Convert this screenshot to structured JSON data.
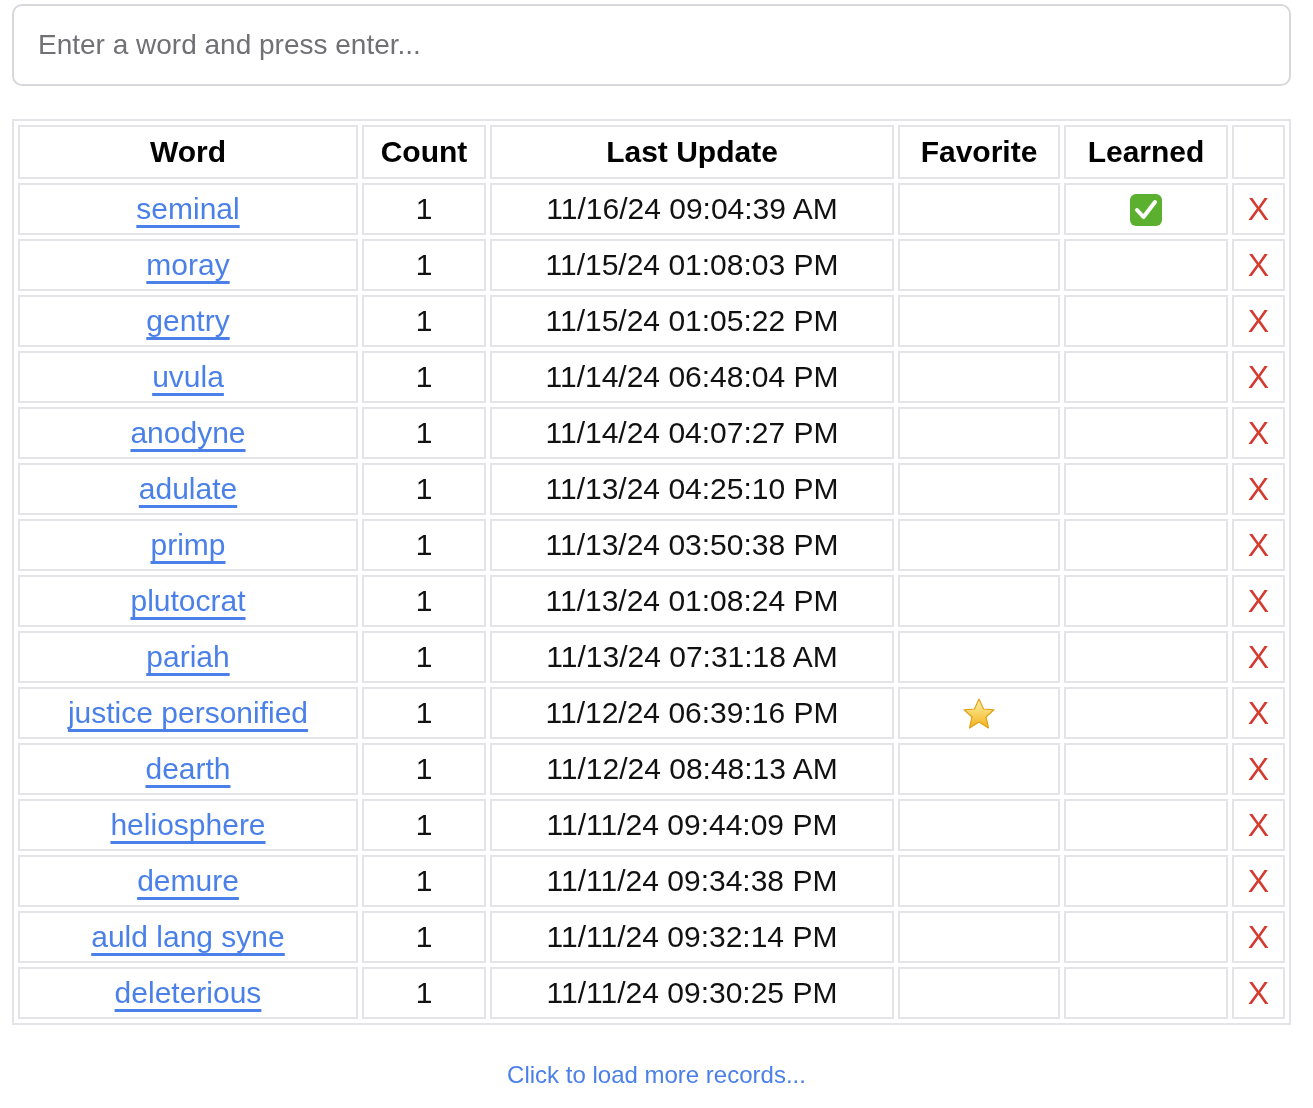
{
  "search": {
    "placeholder": "Enter a word and press enter..."
  },
  "table": {
    "columns": [
      "Word",
      "Count",
      "Last Update",
      "Favorite",
      "Learned"
    ],
    "rows": [
      {
        "word": "seminal",
        "count": "1",
        "last_update": "11/16/24 09:04:39 AM",
        "favorite": false,
        "learned": true,
        "delete": "X"
      },
      {
        "word": "moray",
        "count": "1",
        "last_update": "11/15/24 01:08:03 PM",
        "favorite": false,
        "learned": false,
        "delete": "X"
      },
      {
        "word": "gentry",
        "count": "1",
        "last_update": "11/15/24 01:05:22 PM",
        "favorite": false,
        "learned": false,
        "delete": "X"
      },
      {
        "word": "uvula",
        "count": "1",
        "last_update": "11/14/24 06:48:04 PM",
        "favorite": false,
        "learned": false,
        "delete": "X"
      },
      {
        "word": "anodyne",
        "count": "1",
        "last_update": "11/14/24 04:07:27 PM",
        "favorite": false,
        "learned": false,
        "delete": "X"
      },
      {
        "word": "adulate",
        "count": "1",
        "last_update": "11/13/24 04:25:10 PM",
        "favorite": false,
        "learned": false,
        "delete": "X"
      },
      {
        "word": "primp",
        "count": "1",
        "last_update": "11/13/24 03:50:38 PM",
        "favorite": false,
        "learned": false,
        "delete": "X"
      },
      {
        "word": "plutocrat",
        "count": "1",
        "last_update": "11/13/24 01:08:24 PM",
        "favorite": false,
        "learned": false,
        "delete": "X"
      },
      {
        "word": "pariah",
        "count": "1",
        "last_update": "11/13/24 07:31:18 AM",
        "favorite": false,
        "learned": false,
        "delete": "X"
      },
      {
        "word": "justice personified",
        "count": "1",
        "last_update": "11/12/24 06:39:16 PM",
        "favorite": true,
        "learned": false,
        "delete": "X"
      },
      {
        "word": "dearth",
        "count": "1",
        "last_update": "11/12/24 08:48:13 AM",
        "favorite": false,
        "learned": false,
        "delete": "X"
      },
      {
        "word": "heliosphere",
        "count": "1",
        "last_update": "11/11/24 09:44:09 PM",
        "favorite": false,
        "learned": false,
        "delete": "X"
      },
      {
        "word": "demure",
        "count": "1",
        "last_update": "11/11/24 09:34:38 PM",
        "favorite": false,
        "learned": false,
        "delete": "X"
      },
      {
        "word": "auld lang syne",
        "count": "1",
        "last_update": "11/11/24 09:32:14 PM",
        "favorite": false,
        "learned": false,
        "delete": "X"
      },
      {
        "word": "deleterious",
        "count": "1",
        "last_update": "11/11/24 09:30:25 PM",
        "favorite": false,
        "learned": false,
        "delete": "X"
      }
    ]
  },
  "load_more": "Click to load more records..."
}
